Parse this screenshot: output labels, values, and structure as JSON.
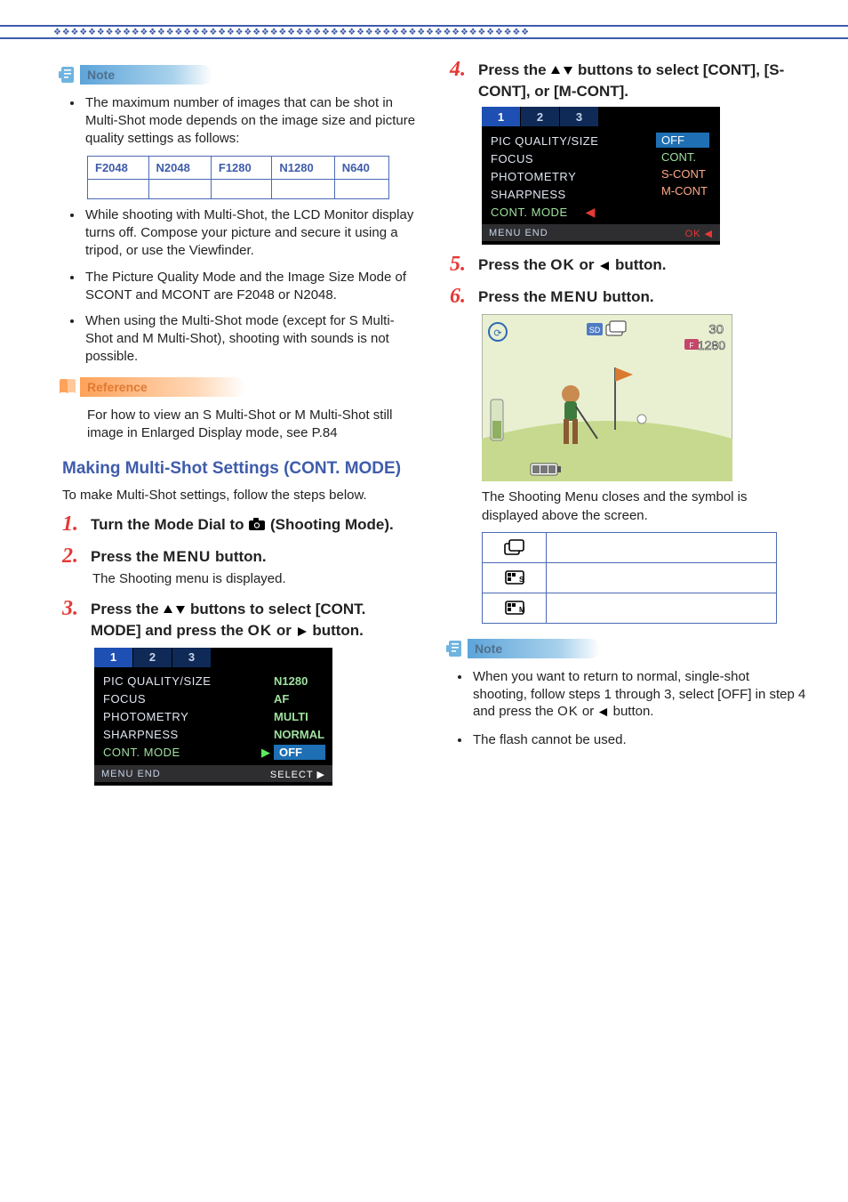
{
  "callouts": {
    "note": "Note",
    "reference": "Reference"
  },
  "left": {
    "note_items": [
      "The maximum number of images that can be shot in Multi-Shot mode depends on the image size and picture quality settings as follows:"
    ],
    "table_headers": [
      "F2048",
      "N2048",
      "F1280",
      "N1280",
      "N640"
    ],
    "note_items2": [
      "While shooting with Multi-Shot, the LCD Monitor display turns off. Compose your picture and secure it using a tripod, or use the Viewfinder.",
      "The Picture Quality Mode and the Image Size Mode of SCONT and MCONT are F2048 or N2048.",
      "When using the Multi-Shot mode (except for S Multi-Shot and M Multi-Shot), shooting with sounds is not possible."
    ],
    "reference_text": "For how to view an S Multi-Shot or M Multi-Shot still image in Enlarged Display mode, see P.84",
    "heading": "Making Multi-Shot Settings (CONT. MODE)",
    "intro": "To make Multi-Shot settings, follow the steps below.",
    "steps": {
      "s1_pre": "Turn the Mode Dial to ",
      "s1_post": " (Shooting Mode).",
      "s2_pre": "Press the ",
      "s2_menu": "MENU",
      "s2_post": " button.",
      "s2_sub": "The Shooting menu is displayed.",
      "s3_pre": "Press the  ",
      "s3_mid": " buttons to select [CONT. MODE] and press the ",
      "s3_ok": "OK",
      "s3_or": " or ",
      "s3_post": " button."
    },
    "lcd1": {
      "tabs": [
        "1",
        "2",
        "3"
      ],
      "rows": [
        {
          "l": "PIC QUALITY/SIZE",
          "r": "N1280"
        },
        {
          "l": "FOCUS",
          "r": "AF"
        },
        {
          "l": "PHOTOMETRY",
          "r": "MULTI"
        },
        {
          "l": "SHARPNESS",
          "r": "NORMAL"
        }
      ],
      "sel": {
        "l": "CONT. MODE",
        "r": "OFF"
      },
      "foot_l": "MENU END",
      "foot_r": "SELECT ▶"
    }
  },
  "right": {
    "s4_pre": "Press the ",
    "s4_post": " buttons to select [CONT], [S-CONT], or [M-CONT].",
    "lcd2": {
      "tabs": [
        "1",
        "2",
        "3"
      ],
      "rows_l": [
        "PIC QUALITY/SIZE",
        "FOCUS",
        "PHOTOMETRY",
        "SHARPNESS"
      ],
      "sel_l": "CONT. MODE",
      "opts": [
        "OFF",
        "CONT.",
        "S-CONT",
        "M-CONT"
      ],
      "foot_l": "MENU END",
      "foot_r": "OK ◀"
    },
    "s5_pre": "Press the ",
    "s5_ok": "OK",
    "s5_or": " or ",
    "s5_post": " button.",
    "s6_pre": "Press the ",
    "s6_menu": "MENU",
    "s6_post": " button.",
    "scene_count": "30",
    "scene_size": "1280",
    "after_scene": "The Shooting Menu closes and the symbol is displayed above the screen.",
    "note_items": [
      "When you want to return to normal, single-shot shooting, follow steps 1 through 3, select [OFF] in step 4 and press the ",
      "The flash cannot be used."
    ],
    "note1_ok": "OK",
    "note1_or": " or ",
    "note1_post": " button."
  }
}
